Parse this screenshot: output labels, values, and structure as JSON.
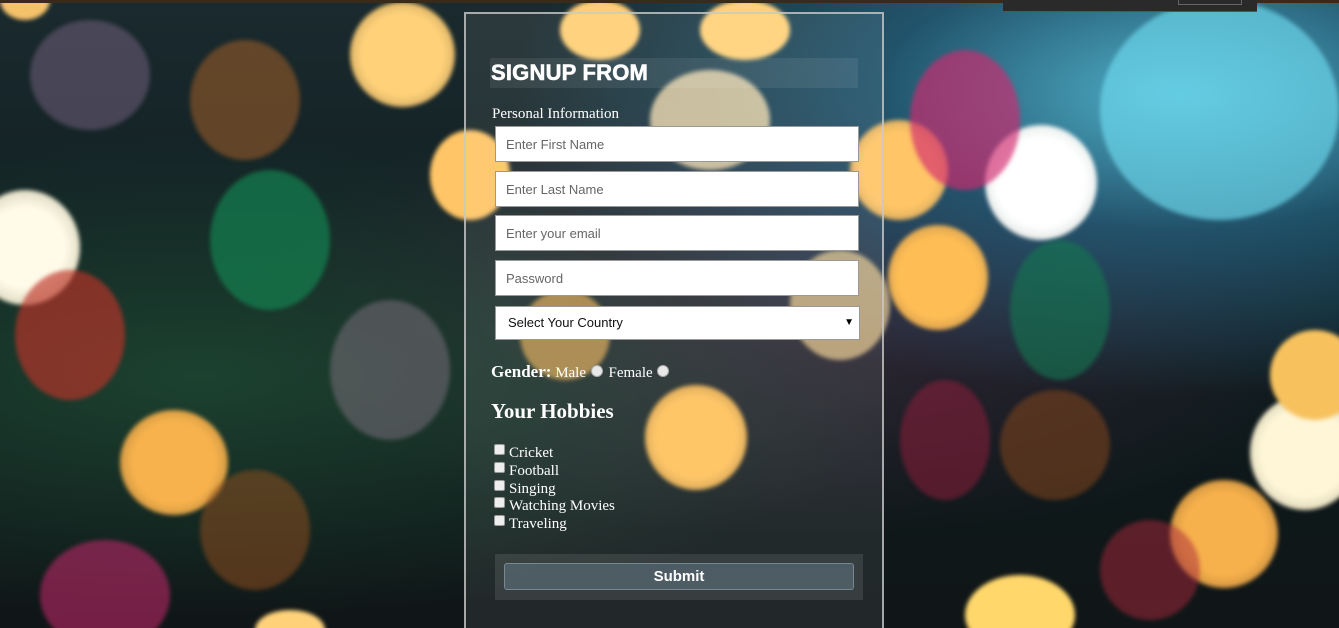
{
  "form": {
    "title": "SIGNUP FROM",
    "section_label": "Personal Information",
    "first_name": {
      "placeholder": "Enter First Name",
      "value": ""
    },
    "last_name": {
      "placeholder": "Enter Last Name",
      "value": ""
    },
    "email": {
      "placeholder": "Enter your email",
      "value": ""
    },
    "password": {
      "placeholder": "Password",
      "value": ""
    },
    "country_select": {
      "selected": "Select Your Country"
    },
    "gender": {
      "label": "Gender:",
      "options": [
        "Male",
        "Female"
      ]
    },
    "hobbies_title": "Your Hobbies",
    "hobbies": [
      "Cricket",
      "Football",
      "Singing",
      "Watching Movies",
      "Traveling"
    ],
    "submit_label": "Submit"
  },
  "icons": {
    "select_arrow": "caret-down-icon"
  },
  "colors": {
    "text": "#ffffff",
    "input_bg": "#ffffff",
    "form_border": "#c8c8c8"
  }
}
